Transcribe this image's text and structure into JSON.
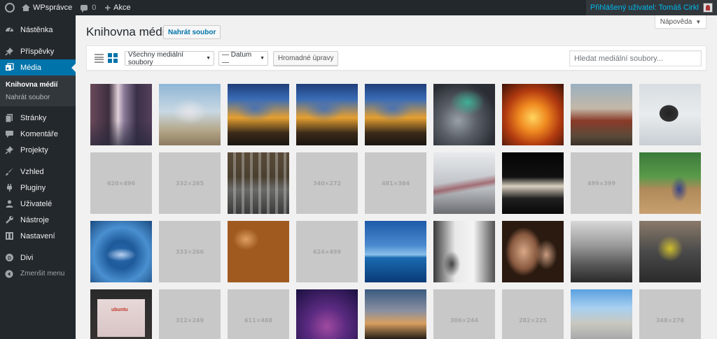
{
  "adminbar": {
    "site_name": "WPsprávce",
    "comments_count": "0",
    "new_label": "Akce",
    "user_text": "Přihlášený uživatel: Tomáš Cirkl"
  },
  "sidebar": {
    "items": [
      {
        "label": "Nástěnka",
        "icon": "dashboard-icon"
      },
      {
        "label": "Příspěvky",
        "icon": "pin-icon"
      },
      {
        "label": "Média",
        "icon": "media-icon"
      },
      {
        "label": "Stránky",
        "icon": "pages-icon"
      },
      {
        "label": "Komentáře",
        "icon": "comments-icon"
      },
      {
        "label": "Projekty",
        "icon": "pin-icon"
      },
      {
        "label": "Vzhled",
        "icon": "brush-icon"
      },
      {
        "label": "Pluginy",
        "icon": "plugin-icon"
      },
      {
        "label": "Uživatelé",
        "icon": "users-icon"
      },
      {
        "label": "Nástroje",
        "icon": "wrench-icon"
      },
      {
        "label": "Nastavení",
        "icon": "settings-icon"
      },
      {
        "label": "Divi",
        "icon": "divi-icon"
      },
      {
        "label": "Zmenšit menu",
        "icon": "collapse-icon"
      }
    ],
    "submenu": [
      "Knihovna médií",
      "Nahrát soubor"
    ]
  },
  "main": {
    "help_label": "Nápověda",
    "title": "Knihovna médií",
    "add_new_label": "Nahrát soubor",
    "filter_type": "Všechny mediální soubory",
    "filter_date": "— Datum —",
    "bulk_label": "Hromadné úpravy",
    "search_placeholder": "Hledat mediální soubory..."
  },
  "placeholders": [
    "620×496",
    "332×265",
    "340×272",
    "481×384",
    "499×399",
    "333×266",
    "624×499",
    "312×249",
    "611×488",
    "306×244",
    "282×225",
    "348×278"
  ],
  "colors": {
    "accent": "#0073aa",
    "sidebar_bg": "#23282d",
    "adminbar_bg": "#23282d",
    "placeholder_bg": "#c8c8c8"
  }
}
